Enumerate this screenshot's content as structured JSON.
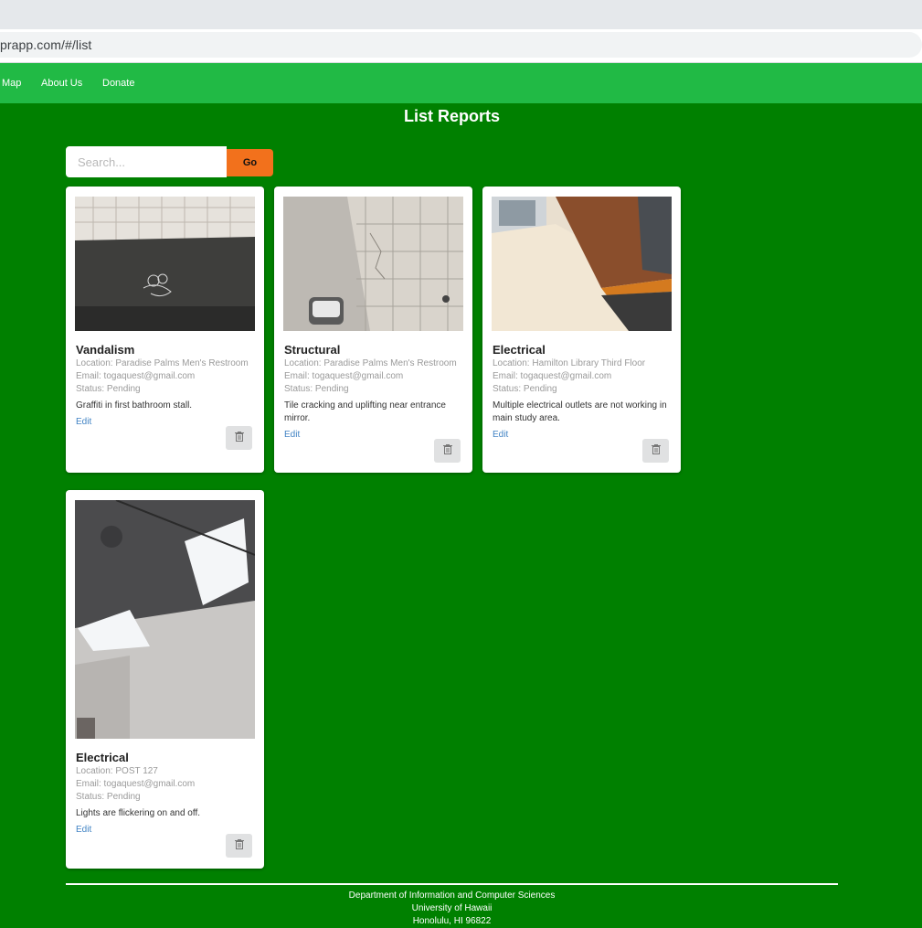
{
  "browser": {
    "url": "prapp.com/#/list"
  },
  "nav": {
    "items": [
      "Map",
      "About Us",
      "Donate"
    ]
  },
  "page": {
    "title": "List Reports"
  },
  "search": {
    "placeholder": "Search...",
    "go_label": "Go"
  },
  "reports": [
    {
      "category": "Vandalism",
      "location": "Location: Paradise Palms Men's Restroom",
      "email": "Email: togaquest@gmail.com",
      "status": "Status: Pending",
      "description": "Graffiti in first bathroom stall.",
      "edit_label": "Edit"
    },
    {
      "category": "Structural",
      "location": "Location: Paradise Palms Men's Restroom",
      "email": "Email: togaquest@gmail.com",
      "status": "Status: Pending",
      "description": "Tile cracking and uplifting near entrance mirror.",
      "edit_label": "Edit"
    },
    {
      "category": "Electrical",
      "location": "Location: Hamilton Library Third Floor",
      "email": "Email: togaquest@gmail.com",
      "status": "Status: Pending",
      "description": "Multiple electrical outlets are not working in main study area.",
      "edit_label": "Edit"
    },
    {
      "category": "Electrical",
      "location": "Location: POST 127",
      "email": "Email: togaquest@gmail.com",
      "status": "Status: Pending",
      "description": "Lights are flickering on and off.",
      "edit_label": "Edit"
    }
  ],
  "footer": {
    "line1": "Department of Information and Computer Sciences",
    "line2": "University of Hawaii",
    "line3": "Honolulu, HI 96822"
  },
  "colors": {
    "page_bg": "#008000",
    "navbar_bg": "#21ba45",
    "go_button": "#f2711c",
    "link": "#4183c4"
  },
  "icons": {
    "delete": "trash-icon"
  }
}
